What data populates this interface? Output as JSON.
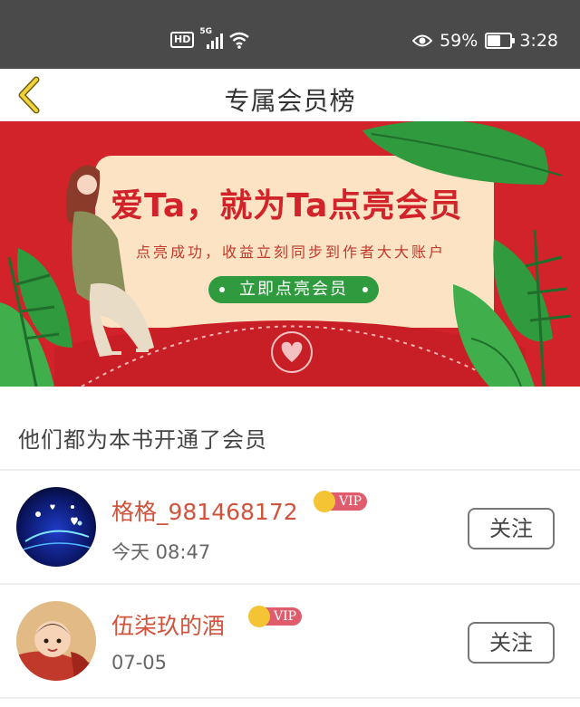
{
  "status_bar": {
    "hd_label": "HD",
    "network_label": "5G",
    "battery_percent": "59%",
    "battery_level": 0.59,
    "time": "3:28"
  },
  "header": {
    "title": "专属会员榜",
    "back_icon": "chevron-left-icon"
  },
  "banner": {
    "title": "爱Ta，就为Ta点亮会员",
    "subtitle": "点亮成功，收益立刻同步到作者大大账户",
    "button_label": "立即点亮会员",
    "colors": {
      "background": "#d2232a",
      "card": "#fbe3c4",
      "leaf": "#2f9a3e",
      "button": "#2f9a3e"
    }
  },
  "section": {
    "title": "他们都为本书开通了会员"
  },
  "members": [
    {
      "name": "格格_981468172",
      "time": "今天 08:47",
      "vip_label": "VIP",
      "follow_label": "关注"
    },
    {
      "name": "伍柒玖的酒",
      "time": "07-05",
      "vip_label": "VIP",
      "follow_label": "关注"
    }
  ],
  "colors": {
    "accent_name": "#d1533c",
    "vip_tag": "#e05b6b",
    "vip_crown": "#f4c435",
    "back_arrow": "#e7c531"
  }
}
